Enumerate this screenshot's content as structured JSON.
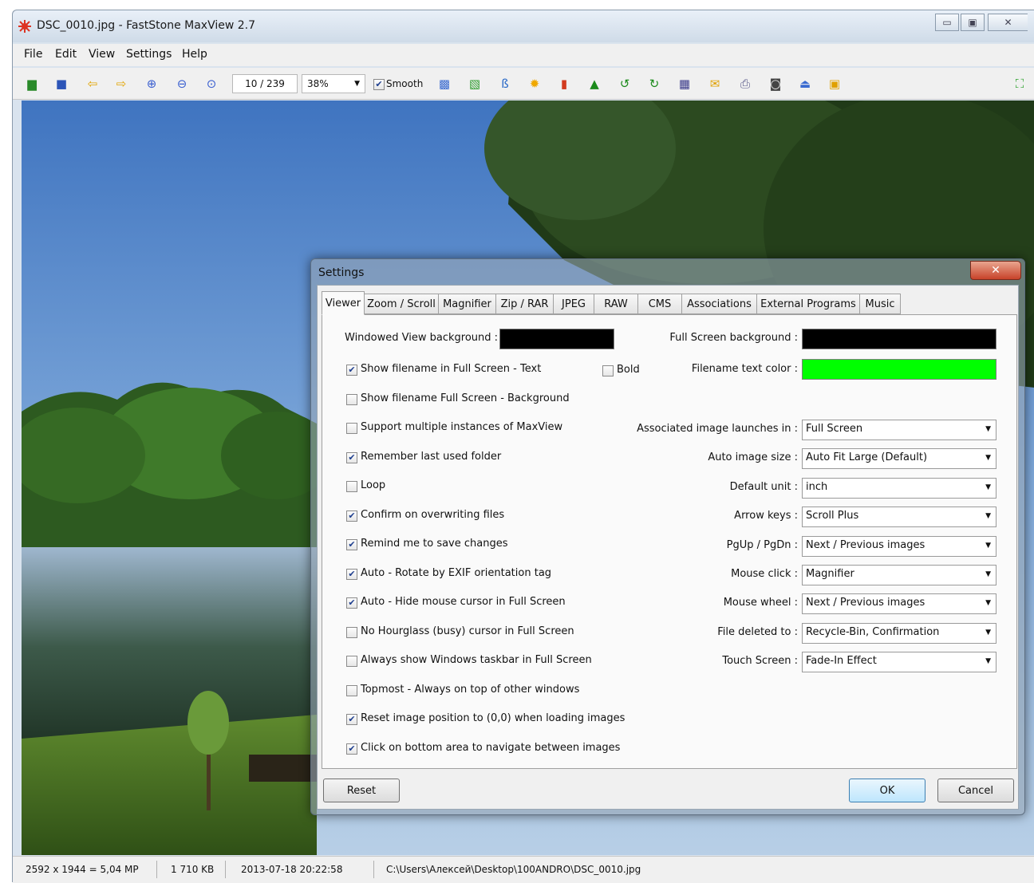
{
  "window": {
    "title": "DSC_0010.jpg - FastStone MaxView 2.7",
    "caption_buttons": [
      "▭",
      "▣",
      "✕"
    ]
  },
  "menubar": [
    "File",
    "Edit",
    "View",
    "Settings",
    "Help"
  ],
  "toolbar": {
    "page_counter": "10 / 239",
    "zoom": "38%",
    "smooth_label": "Smooth",
    "smooth_checked": true
  },
  "statusbar": {
    "dimensions": "2592 x 1944 = 5,04 MP",
    "filesize": "1 710 KB",
    "datetime": "2013-07-18 20:22:58",
    "path": "C:\\Users\\Алексей\\Desktop\\100ANDRO\\DSC_0010.jpg"
  },
  "dialog": {
    "title": "Settings",
    "close": "✕",
    "tabs": [
      "Viewer",
      "Zoom / Scroll",
      "Magnifier",
      "Zip / RAR",
      "JPEG",
      "RAW",
      "CMS",
      "Associations",
      "External Programs",
      "Music"
    ],
    "windowed_bg_label": "Windowed View background :",
    "windowed_bg_color": "#000000",
    "fullscreen_bg_label": "Full Screen background :",
    "fullscreen_bg_color": "#000000",
    "filename_color_label": "Filename text color :",
    "filename_color": "#00ff00",
    "bold_label": "Bold",
    "bold_checked": false,
    "checkboxes": [
      {
        "label": "Show filename in Full Screen - Text",
        "checked": true
      },
      {
        "label": "Show filename Full Screen - Background",
        "checked": false
      },
      {
        "label": "Support multiple instances of MaxView",
        "checked": false
      },
      {
        "label": "Remember last used folder",
        "checked": true
      },
      {
        "label": "Loop",
        "checked": false
      },
      {
        "label": "Confirm on overwriting files",
        "checked": true
      },
      {
        "label": "Remind me to save changes",
        "checked": true
      },
      {
        "label": "Auto - Rotate by EXIF orientation tag",
        "checked": true
      },
      {
        "label": "Auto - Hide mouse cursor in Full Screen",
        "checked": true
      },
      {
        "label": "No Hourglass (busy) cursor in Full Screen",
        "checked": false
      },
      {
        "label": "Always show Windows taskbar in Full Screen",
        "checked": false
      },
      {
        "label": "Topmost - Always on top of other windows",
        "checked": false
      },
      {
        "label": "Reset image position to (0,0) when loading images",
        "checked": true
      },
      {
        "label": "Click on bottom area to navigate between images",
        "checked": true
      }
    ],
    "dropdowns": [
      {
        "label": "Associated image launches in :",
        "value": "Full Screen"
      },
      {
        "label": "Auto image size :",
        "value": "Auto Fit Large (Default)"
      },
      {
        "label": "Default unit :",
        "value": "inch"
      },
      {
        "label": "Arrow keys :",
        "value": "Scroll Plus"
      },
      {
        "label": "PgUp / PgDn :",
        "value": "Next / Previous images"
      },
      {
        "label": "Mouse click :",
        "value": "Magnifier"
      },
      {
        "label": "Mouse wheel :",
        "value": "Next / Previous images"
      },
      {
        "label": "File deleted to :",
        "value": "Recycle-Bin, Confirmation"
      },
      {
        "label": "Touch Screen :",
        "value": "Fade-In Effect"
      }
    ],
    "reset_label": "Reset",
    "ok_label": "OK",
    "cancel_label": "Cancel"
  },
  "icons": {
    "toolbar": [
      "open-folder-icon",
      "save-icon",
      "previous-icon",
      "next-icon",
      "zoom-in-icon",
      "zoom-out-icon",
      "actual-size-icon",
      "resize-icon",
      "crop-icon",
      "text-icon",
      "adjust-colors-icon",
      "effects-icon",
      "sharpen-icon",
      "rotate-left-icon",
      "rotate-right-icon",
      "slideshow-icon",
      "email-icon",
      "print-icon",
      "screen-capture-icon",
      "scanner-icon",
      "wallpaper-icon",
      "fullscreen-icon"
    ]
  }
}
